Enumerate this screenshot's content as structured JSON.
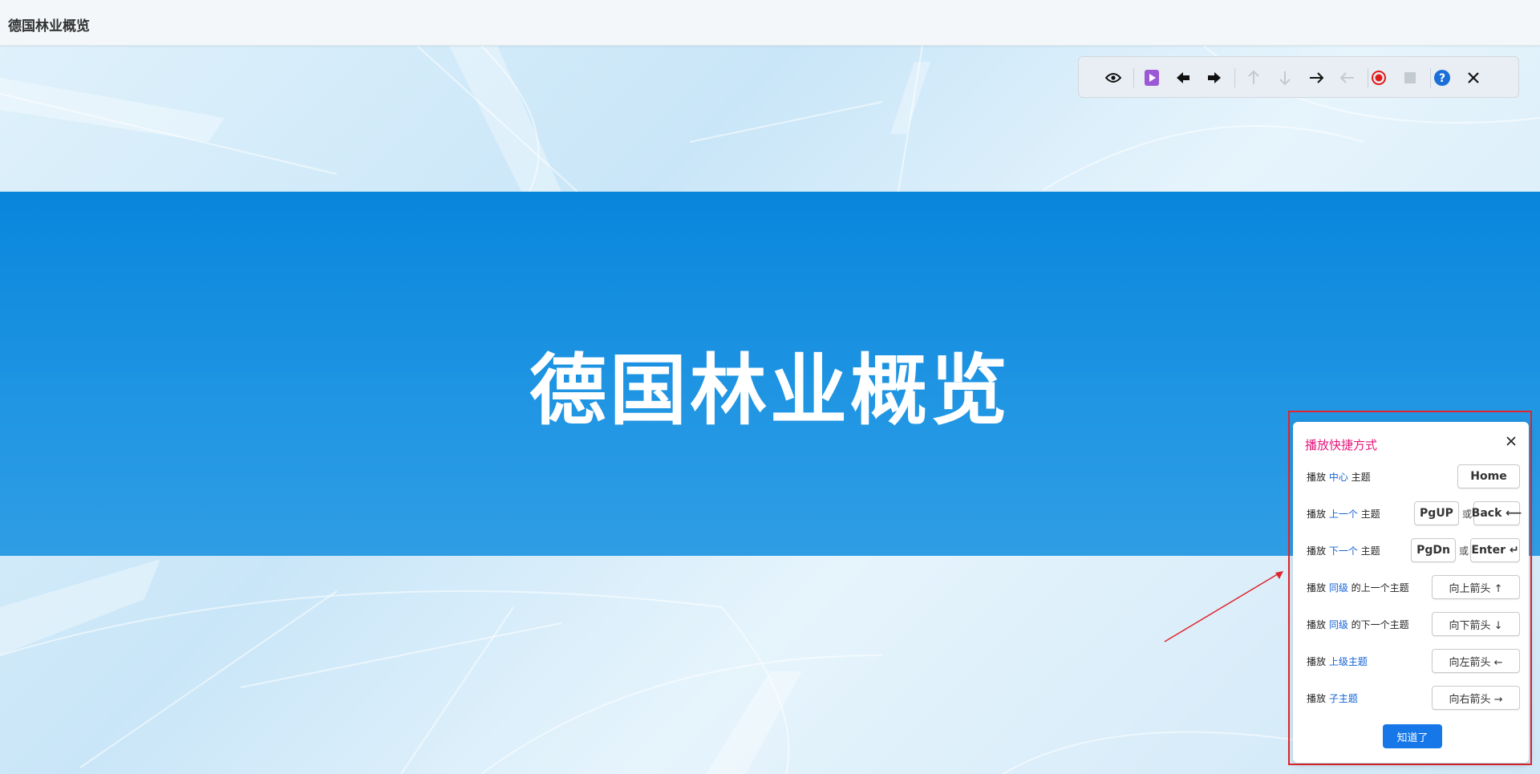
{
  "app": {
    "title": "德国林业概览"
  },
  "slide": {
    "title": "德国林业概览"
  },
  "toolbar": {
    "buttons": [
      "eye-icon",
      "play-icon",
      "prev-slide-icon",
      "next-slide-icon",
      "arrow-up-icon",
      "arrow-down-icon",
      "arrow-right-icon",
      "arrow-left-icon",
      "record-icon",
      "stop-icon",
      "help-icon",
      "close-icon"
    ]
  },
  "shortcuts": {
    "title": "播放快捷方式",
    "ok_label": "知道了",
    "or_text": "或",
    "rows": [
      {
        "prefix": "播放 ",
        "highlight": "中心",
        "suffix": " 主题",
        "keys": [
          "Home"
        ]
      },
      {
        "prefix": "播放 ",
        "highlight": "上一个",
        "suffix": " 主题",
        "keys": [
          "PgUP",
          "Back ⟵"
        ]
      },
      {
        "prefix": "播放 ",
        "highlight": "下一个",
        "suffix": " 主题",
        "keys": [
          "PgDn",
          "Enter ↵"
        ]
      },
      {
        "prefix": "播放 ",
        "highlight": "同级",
        "suffix": " 的上一个主题",
        "keys": [
          "向上箭头 ↑"
        ]
      },
      {
        "prefix": "播放 ",
        "highlight": "同级",
        "suffix": " 的下一个主题",
        "keys": [
          "向下箭头 ↓"
        ]
      },
      {
        "prefix": "播放 ",
        "highlight": "上级主题",
        "suffix": "",
        "keys": [
          "向左箭头 ←"
        ]
      },
      {
        "prefix": "播放 ",
        "highlight": "子主题",
        "suffix": "",
        "keys": [
          "向右箭头 →"
        ]
      }
    ]
  },
  "colors": {
    "band": "#0886dc",
    "dialog_title": "#e4157a",
    "highlight": "#1462d6",
    "ok_button": "#1677e8",
    "annotation": "#e0262d"
  }
}
